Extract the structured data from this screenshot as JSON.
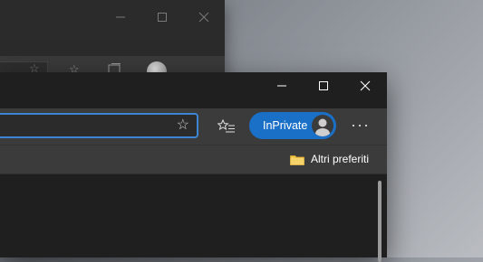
{
  "background_window": {
    "controls": {
      "minimize": "minimize",
      "maximize": "maximize",
      "close": "close"
    }
  },
  "window": {
    "controls": {
      "minimize": "minimize",
      "maximize": "maximize",
      "close": "close"
    }
  },
  "toolbar": {
    "address_value": "",
    "favorite_star_icon": "star-icon",
    "favorites_icon": "favorites-list-icon",
    "inprivate_label": "InPrivate",
    "more_label": "···"
  },
  "favorites_bar": {
    "folder_label": "Altri preferiti",
    "folder_color": "#f2c94c"
  },
  "colors": {
    "accent": "#1a6fc7",
    "address_focus_border": "#3a86d4"
  }
}
